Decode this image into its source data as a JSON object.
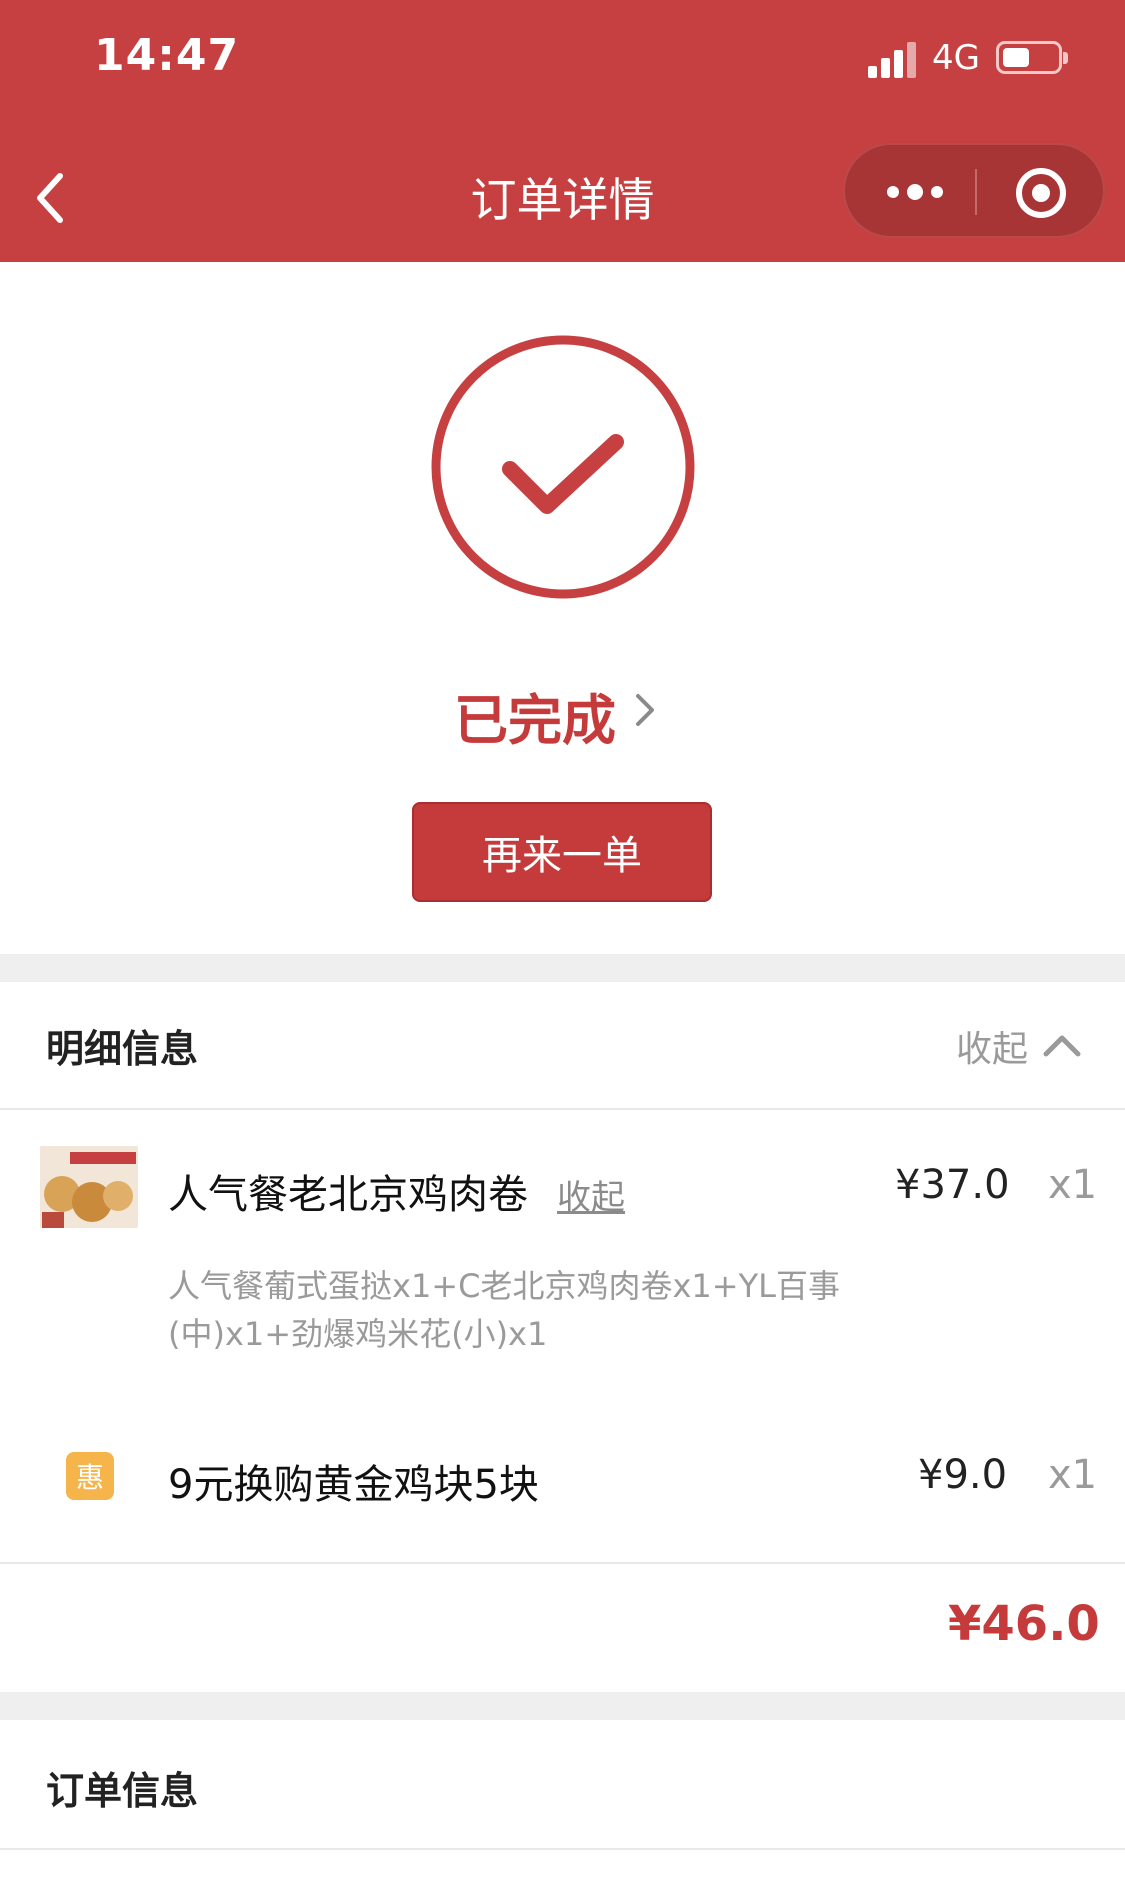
{
  "status_bar": {
    "time": "14:47",
    "network": "4G"
  },
  "nav": {
    "title": "订单详情"
  },
  "order_status": {
    "label": "已完成",
    "action_button": "再来一单"
  },
  "details": {
    "title": "明细信息",
    "collapse_label": "收起",
    "items": [
      {
        "name": "人气餐老北京鸡肉卷",
        "inline_toggle": "收起",
        "price": "¥37.0",
        "qty": "x1",
        "description": "人气餐葡式蛋挞x1+C老北京鸡肉卷x1+YL百事(中)x1+劲爆鸡米花(小)x1"
      },
      {
        "badge": "惠",
        "name": "9元换购黄金鸡块5块",
        "price": "¥9.0",
        "qty": "x1"
      }
    ],
    "total": "¥46.0"
  },
  "order_info": {
    "title": "订单信息"
  },
  "colors": {
    "brand_red": "#c64041",
    "accent_red": "#c53a3b",
    "badge_orange": "#f6b54b"
  }
}
